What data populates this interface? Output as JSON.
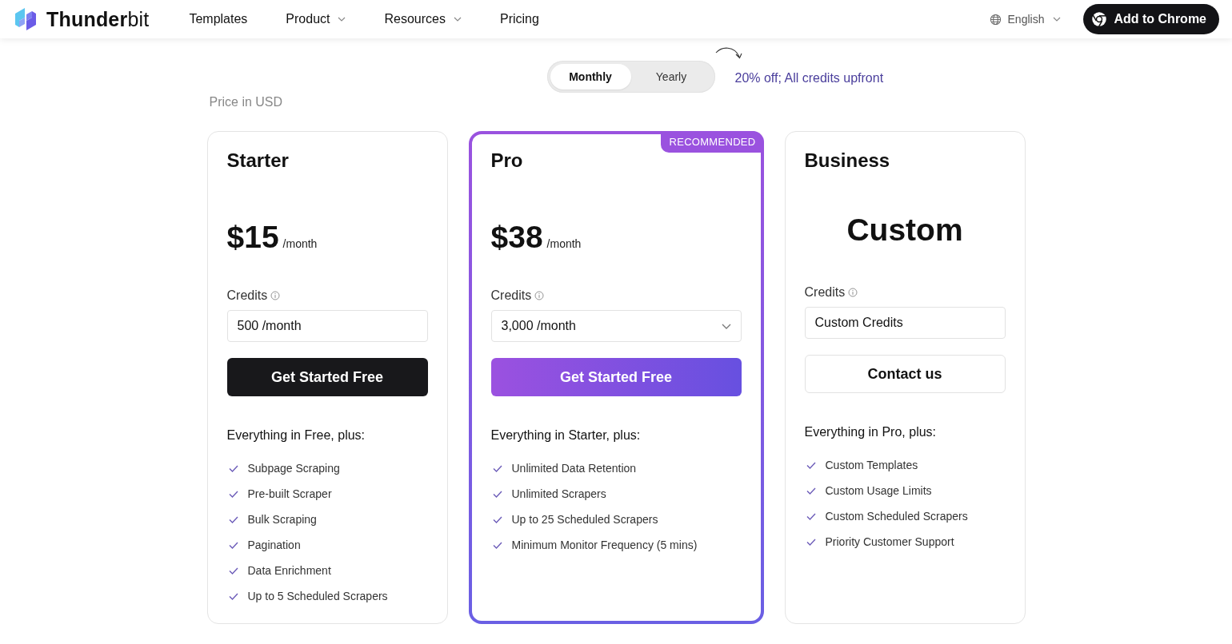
{
  "header": {
    "logo": "**Thunder**bit",
    "nav": [
      {
        "label": "Templates",
        "dropdown": false
      },
      {
        "label": "Product",
        "dropdown": true
      },
      {
        "label": "Resources",
        "dropdown": true
      },
      {
        "label": "Pricing",
        "dropdown": false
      }
    ],
    "language": "English",
    "cta": "Add to Chrome"
  },
  "billing_toggle": {
    "options": [
      {
        "label": "Monthly",
        "selected": true
      },
      {
        "label": "Yearly",
        "selected": false
      }
    ],
    "note": "20% off; All credits upfront"
  },
  "currency_note": "Price in USD",
  "plans": [
    {
      "name": "Starter",
      "highlighted": false,
      "price": {
        "kind": "amount",
        "amount": "$15",
        "period": "/month"
      },
      "credits_label": "Credits",
      "credits": {
        "kind": "input",
        "value": "500 /month"
      },
      "button": {
        "kind": "dark",
        "label": "Get Started Free"
      },
      "features_heading": "Everything in Free, plus:",
      "features": [
        "Subpage Scraping",
        "Pre-built Scraper",
        "Bulk Scraping",
        "Pagination",
        "Data Enrichment",
        "Up to 5 Scheduled Scrapers"
      ]
    },
    {
      "name": "Pro",
      "badge": "RECOMMENDED",
      "highlighted": true,
      "price": {
        "kind": "amount",
        "amount": "$38",
        "period": "/month"
      },
      "credits_label": "Credits",
      "credits": {
        "kind": "select",
        "value": "3,000 /month"
      },
      "button": {
        "kind": "gradient",
        "label": "Get Started Free"
      },
      "features_heading": "Everything in Starter, plus:",
      "features": [
        "Unlimited Data Retention",
        "Unlimited Scrapers",
        "Up to 25 Scheduled Scrapers",
        "Minimum Monitor Frequency (5 mins)"
      ]
    },
    {
      "name": "Business",
      "highlighted": false,
      "price": {
        "kind": "custom",
        "amount": "Custom"
      },
      "credits_label": "Credits",
      "credits": {
        "kind": "input",
        "value": "Custom Credits"
      },
      "button": {
        "kind": "outline",
        "label": "Contact us"
      },
      "features_heading": "Everything in Pro, plus:",
      "features": [
        "Custom Templates",
        "Custom Usage Limits",
        "Custom Scheduled Scrapers",
        "Priority Customer Support"
      ]
    }
  ]
}
